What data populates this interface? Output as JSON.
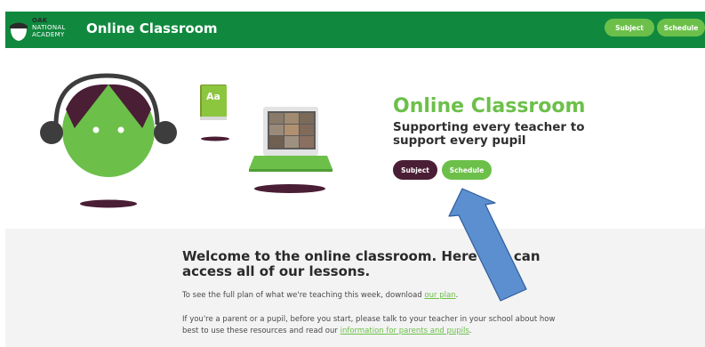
{
  "header": {
    "logo_lines": [
      "OAK",
      "NATIONAL",
      "ACADEMY"
    ],
    "title": "Online Classroom",
    "nav_subject": "Subject",
    "nav_schedule": "Schedule"
  },
  "hero": {
    "title": "Online Classroom",
    "tagline": "Supporting every teacher to support every pupil",
    "subject_button": "Subject",
    "schedule_button": "Schedule",
    "book_label": "Aa"
  },
  "welcome": {
    "heading": "Welcome to the online classroom. Here you can access all of our lessons.",
    "para1_before": "To see the full plan of what we're teaching this week, download ",
    "para1_link": "our plan",
    "para1_after": ".",
    "para2_before": "If you're a parent or a pupil, before you start, please talk to your teacher in your school about how best to use these resources and read our ",
    "para2_link": "information for parents and pupils",
    "para2_after": "."
  },
  "colors": {
    "header_green": "#10893e",
    "accent_green": "#6cc04a",
    "plum": "#4a1e35",
    "annotation_blue": "#5b8fd0"
  }
}
